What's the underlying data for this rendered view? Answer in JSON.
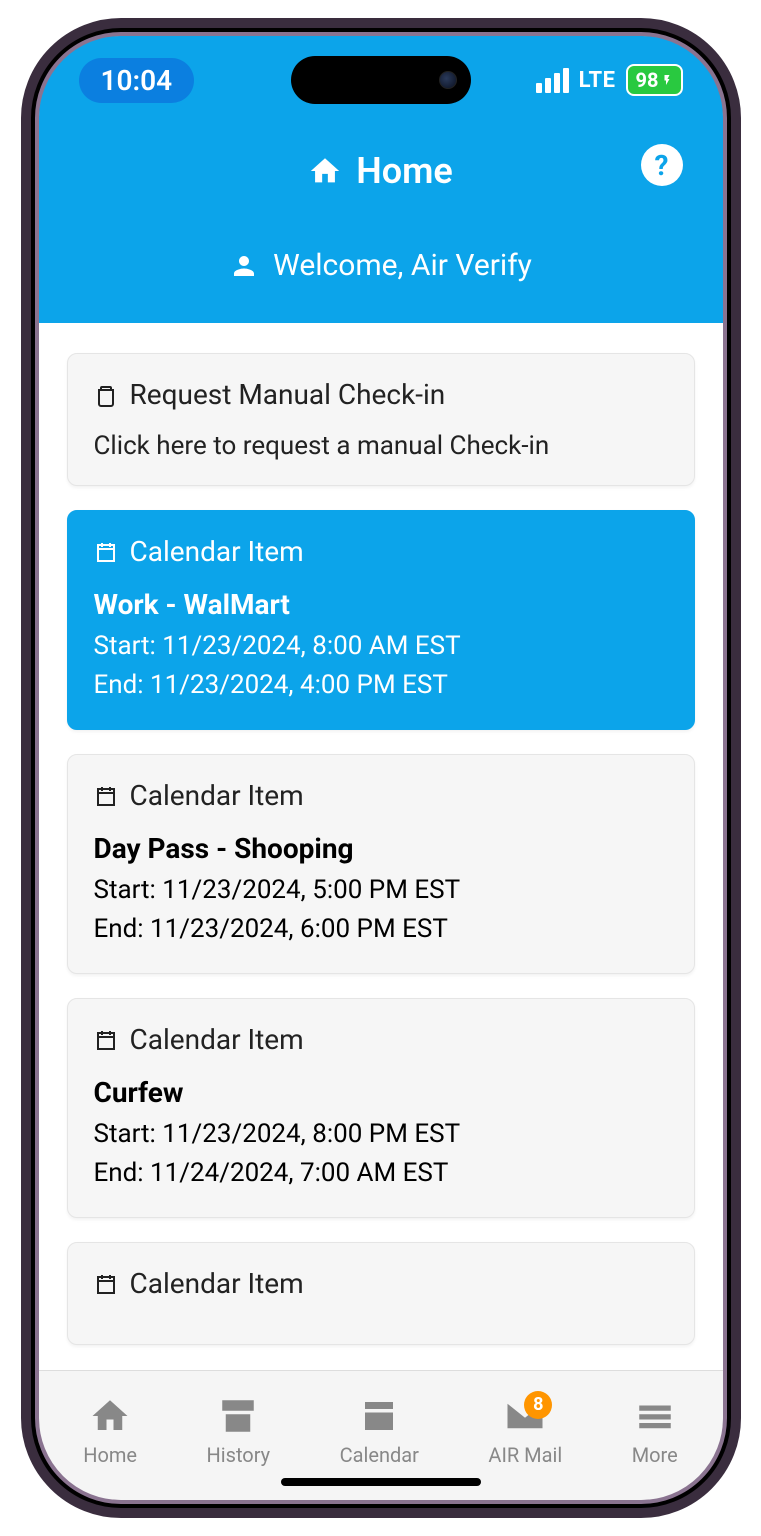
{
  "status": {
    "time": "10:04",
    "network": "LTE",
    "battery": "98"
  },
  "header": {
    "title": "Home",
    "welcome": "Welcome, Air Verify"
  },
  "checkin": {
    "title": "Request Manual Check-in",
    "subtitle": "Click here to request a manual Check-in"
  },
  "calendar_label": "Calendar Item",
  "start_prefix": "Start: ",
  "end_prefix": "End: ",
  "items": [
    {
      "title": "Work - WalMart",
      "start": "11/23/2024, 8:00 AM EST",
      "end": "11/23/2024, 4:00 PM EST",
      "active": true
    },
    {
      "title": "Day Pass - Shooping",
      "start": "11/23/2024, 5:00 PM EST",
      "end": "11/23/2024, 6:00 PM EST",
      "active": false
    },
    {
      "title": "Curfew",
      "start": "11/23/2024, 8:00 PM EST",
      "end": "11/24/2024, 7:00 AM EST",
      "active": false
    },
    {
      "title": "",
      "start": "",
      "end": "",
      "active": false
    }
  ],
  "tabs": {
    "home": "Home",
    "history": "History",
    "calendar": "Calendar",
    "mail": "AIR Mail",
    "more": "More",
    "mail_badge": "8"
  }
}
